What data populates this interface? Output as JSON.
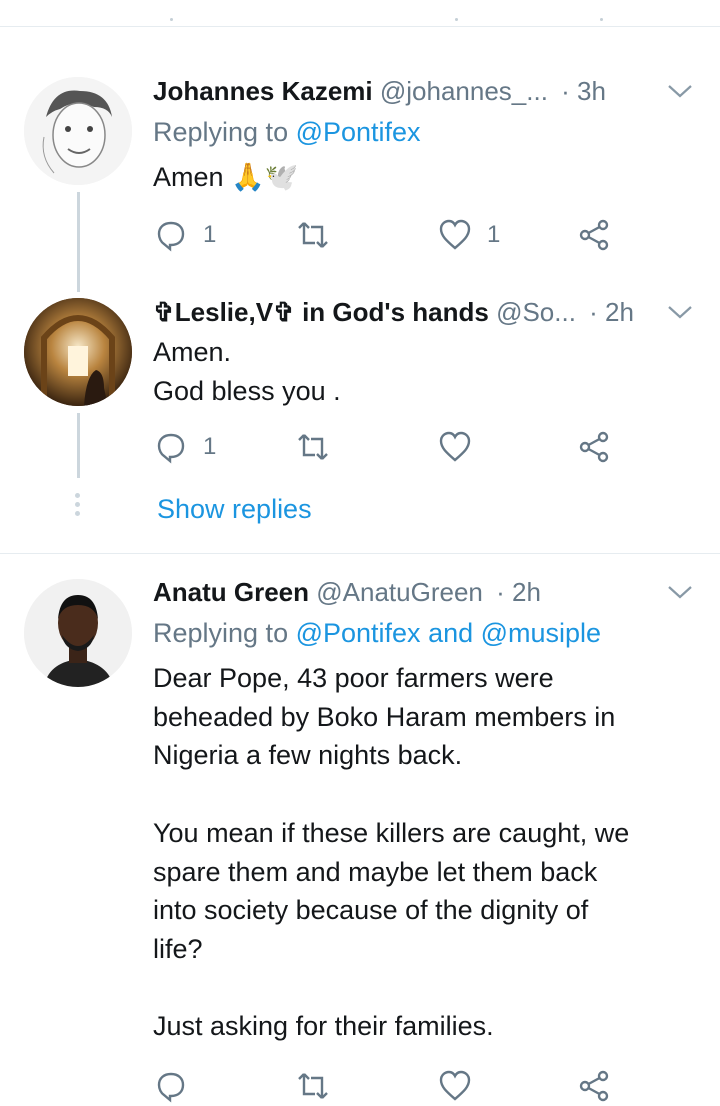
{
  "tweets": [
    {
      "name": "Johannes Kazemi",
      "handle": "@johannes_...",
      "time": "· 3h",
      "replying_prefix": "Replying to ",
      "replying_to": "@Pontifex",
      "text_lines": [
        "Amen 🙏🕊️"
      ],
      "replies": "1",
      "retweets": "",
      "likes": "1"
    },
    {
      "name": "✞Leslie,V✞ in God's hands",
      "handle": "@So...",
      "time": "· 2h",
      "text_lines": [
        "Amen.",
        "God bless you ."
      ],
      "replies": "1",
      "retweets": "",
      "likes": ""
    },
    {
      "name": "Anatu Green",
      "handle": "@AnatuGreen",
      "time": "· 2h",
      "replying_prefix": "Replying to ",
      "replying_to": "@Pontifex and @musiple",
      "text_lines": [
        "Dear Pope, 43 poor farmers were",
        "beheaded by Boko Haram members in",
        "Nigeria a few nights back.",
        "",
        "You mean if these killers are caught, we",
        "spare them and maybe let them back",
        "into society because of the dignity of",
        "life?",
        "",
        "Just asking for their families."
      ]
    }
  ],
  "show_replies": "Show replies",
  "colors": {
    "link": "#1b95e0",
    "muted": "#657786",
    "text": "#14171a",
    "line": "#ccd6dd"
  }
}
